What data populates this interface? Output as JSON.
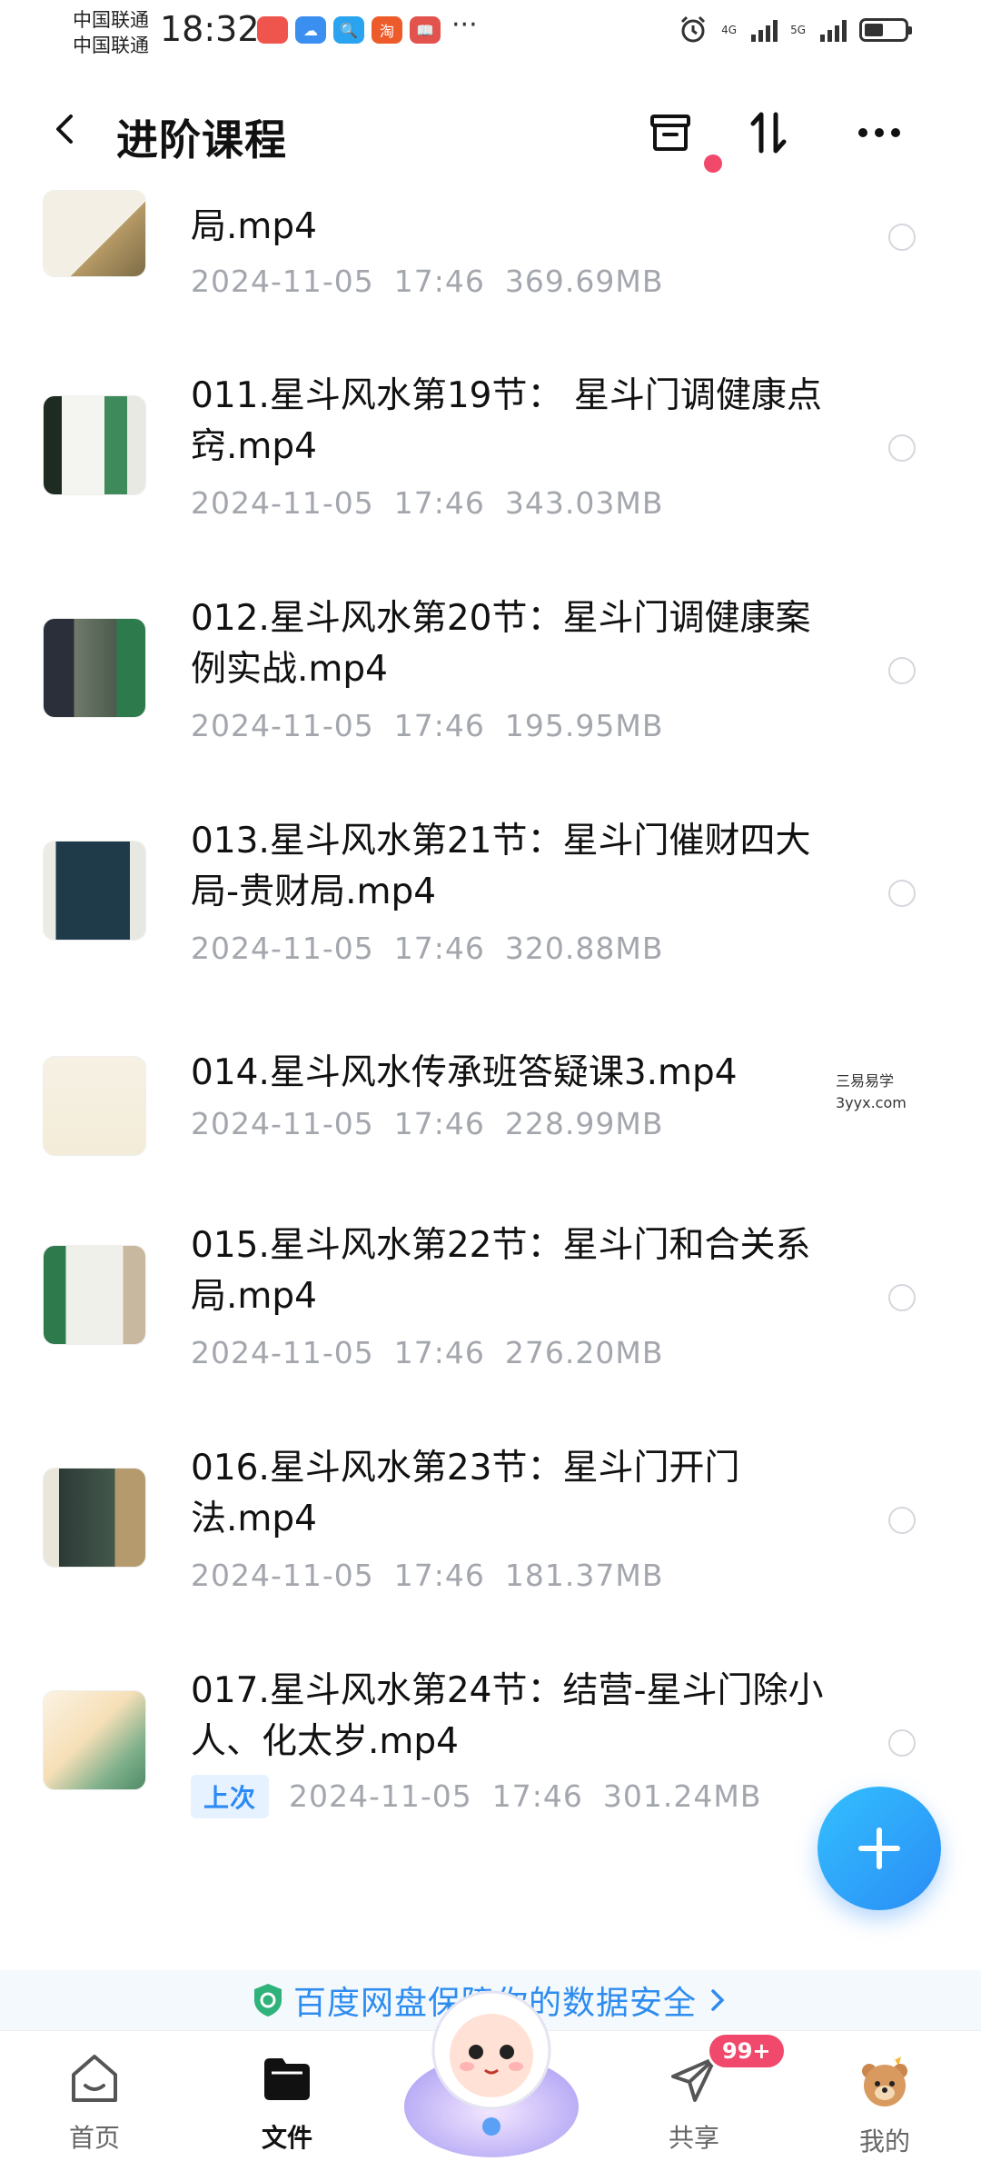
{
  "status_bar": {
    "carrier1": "中国联通",
    "carrier2": "中国联通",
    "time": "18:32",
    "more": "···",
    "net1": "4G",
    "net2": "5G"
  },
  "header": {
    "title": "进阶课程",
    "icons": [
      "back-icon",
      "archive-icon",
      "sort-icon",
      "more-icon"
    ]
  },
  "files": [
    {
      "name": "局.mp4",
      "date": "2024-11-05",
      "time": "17:46",
      "size": "369.69MB"
    },
    {
      "name": "011.星斗风水第19节：  星斗门调健康点窍.mp4",
      "date": "2024-11-05",
      "time": "17:46",
      "size": "343.03MB"
    },
    {
      "name": "012.星斗风水第20节：星斗门调健康案例实战.mp4",
      "date": "2024-11-05",
      "time": "17:46",
      "size": "195.95MB"
    },
    {
      "name": "013.星斗风水第21节：星斗门催财四大局-贵财局.mp4",
      "date": "2024-11-05",
      "time": "17:46",
      "size": "320.88MB"
    },
    {
      "name": "014.星斗风水传承班答疑课3.mp4",
      "date": "2024-11-05",
      "time": "17:46",
      "size": "228.99MB"
    },
    {
      "name": "015.星斗风水第22节：星斗门和合关系局.mp4",
      "date": "2024-11-05",
      "time": "17:46",
      "size": "276.20MB"
    },
    {
      "name": "016.星斗风水第23节：星斗门开门法.mp4",
      "date": "2024-11-05",
      "time": "17:46",
      "size": "181.37MB"
    },
    {
      "name": "017.星斗风水第24节：结营-星斗门除小人、化太岁.mp4",
      "tag": "上次",
      "date": "2024-11-05",
      "time": "17:46",
      "size": "301.24MB"
    }
  ],
  "watermark": {
    "line1": "三易易学",
    "line2": "3yyx.com"
  },
  "banner": {
    "text": "百度网盘保障你的数据安全"
  },
  "bottom_nav": {
    "items": [
      {
        "label": "首页",
        "icon": "home-icon"
      },
      {
        "label": "文件",
        "icon": "folder-icon",
        "active": true
      },
      {
        "label": "",
        "icon": "mascot-icon"
      },
      {
        "label": "共享",
        "icon": "paper-plane-icon",
        "badge": "99+"
      },
      {
        "label": "我的",
        "icon": "bear-avatar-icon"
      }
    ]
  },
  "colors": {
    "accent": "#2a8cf5",
    "badge": "#f1496b",
    "meta": "#a3a7ad"
  }
}
